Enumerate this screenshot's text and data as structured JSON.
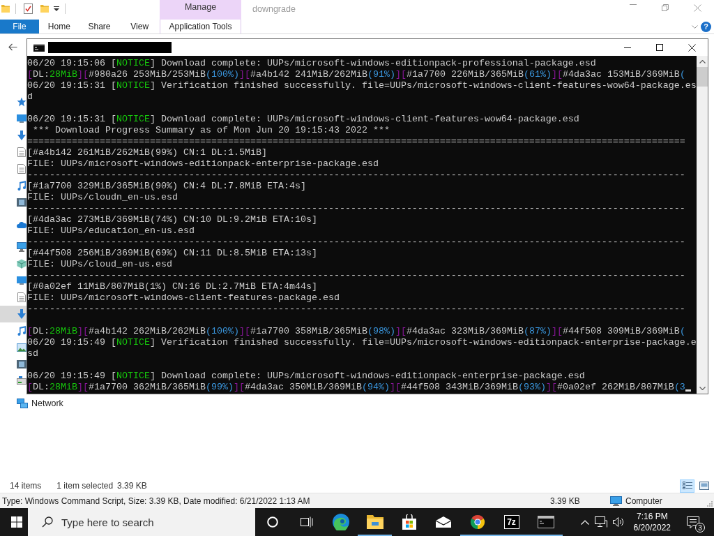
{
  "explorer": {
    "title": "downgrade",
    "contextual_tab_group": {
      "label": "Manage",
      "tab": "Application Tools"
    },
    "ribbon_tabs": [
      {
        "label": "File",
        "kind": "file"
      },
      {
        "label": "Home",
        "kind": "tab"
      },
      {
        "label": "Share",
        "kind": "tab"
      },
      {
        "label": "View",
        "kind": "tab"
      }
    ],
    "help": "?",
    "navigation_pane": {
      "groups": [
        {
          "rows": [
            {
              "kind": "star",
              "selected": false
            },
            {
              "kind": "desktop",
              "selected": false
            },
            {
              "kind": "download",
              "selected": false
            },
            {
              "kind": "document",
              "selected": false
            },
            {
              "kind": "document",
              "selected": false
            },
            {
              "kind": "music",
              "selected": false
            },
            {
              "kind": "video",
              "selected": false
            }
          ]
        },
        {
          "rows": [
            {
              "kind": "cloud",
              "selected": false
            }
          ]
        },
        {
          "rows": [
            {
              "kind": "computer",
              "selected": false
            },
            {
              "kind": "cube",
              "selected": false
            },
            {
              "kind": "desktop",
              "selected": false
            },
            {
              "kind": "document",
              "selected": false
            },
            {
              "kind": "download",
              "selected": true
            },
            {
              "kind": "music",
              "selected": false
            },
            {
              "kind": "pictures",
              "selected": false
            },
            {
              "kind": "video",
              "selected": false
            },
            {
              "kind": "drive",
              "selected": false
            }
          ]
        },
        {
          "rows": [
            {
              "kind": "network",
              "label": "Network",
              "selected": false
            }
          ]
        }
      ]
    },
    "status_bar": {
      "item_count": "14 items",
      "selection": "1 item selected",
      "selection_size": "3.39 KB"
    },
    "view_buttons": [
      {
        "kind": "details",
        "selected": true
      },
      {
        "kind": "large-icons",
        "selected": false
      }
    ],
    "details_bar": {
      "description": "Type: Windows Command Script, Size: 3.39 KB, Date modified: 6/21/2022 1:13 AM",
      "size": "3.39 KB",
      "location": "Computer"
    }
  },
  "console": {
    "cursor_visible": true,
    "lines": [
      {
        "kind": "text",
        "segments": [
          {
            "kind": "plain",
            "text": "06/20 19:15:06 ["
          },
          {
            "kind": "notice",
            "text": "NOTICE"
          },
          {
            "kind": "plain",
            "text": "] Download complete: UUPs/microsoft-windows-editionpack-professional-package.esd"
          }
        ]
      },
      {
        "kind": "text",
        "segments": [
          {
            "kind": "bracket",
            "text": "["
          },
          {
            "kind": "plain",
            "text": "DL:"
          },
          {
            "kind": "rate",
            "text": "28MiB"
          },
          {
            "kind": "bracket",
            "text": "]["
          },
          {
            "kind": "plain",
            "text": "#980a26 253MiB/253MiB"
          },
          {
            "kind": "percent",
            "text": "(100%)"
          },
          {
            "kind": "bracket",
            "text": "]["
          },
          {
            "kind": "plain",
            "text": "#a4b142 241MiB/262MiB"
          },
          {
            "kind": "percent",
            "text": "(91%)"
          },
          {
            "kind": "bracket",
            "text": "]["
          },
          {
            "kind": "plain",
            "text": "#1a7700 226MiB/365MiB"
          },
          {
            "kind": "percent",
            "text": "(61%)"
          },
          {
            "kind": "bracket",
            "text": "]["
          },
          {
            "kind": "plain",
            "text": "#4da3ac 153MiB/369MiB"
          },
          {
            "kind": "percent",
            "text": "("
          }
        ]
      },
      {
        "kind": "text",
        "segments": [
          {
            "kind": "plain",
            "text": "06/20 19:15:31 ["
          },
          {
            "kind": "notice",
            "text": "NOTICE"
          },
          {
            "kind": "plain",
            "text": "] Verification finished successfully. file=UUPs/microsoft-windows-client-features-wow64-package.es"
          }
        ]
      },
      {
        "kind": "text",
        "segments": [
          {
            "kind": "plain",
            "text": "d"
          }
        ]
      },
      {
        "kind": "blank"
      },
      {
        "kind": "text",
        "segments": [
          {
            "kind": "plain",
            "text": "06/20 19:15:31 ["
          },
          {
            "kind": "notice",
            "text": "NOTICE"
          },
          {
            "kind": "plain",
            "text": "] Download complete: UUPs/microsoft-windows-client-features-wow64-package.esd"
          }
        ]
      },
      {
        "kind": "text",
        "segments": [
          {
            "kind": "plain",
            "text": " *** Download Progress Summary as of Mon Jun 20 19:15:43 2022 ***"
          }
        ]
      },
      {
        "kind": "text",
        "segments": [
          {
            "kind": "plain",
            "text": "======================================================================================================================"
          }
        ]
      },
      {
        "kind": "text",
        "segments": [
          {
            "kind": "plain",
            "text": "[#a4b142 261MiB/262MiB(99%) CN:1 DL:1.5MiB]"
          }
        ]
      },
      {
        "kind": "text",
        "segments": [
          {
            "kind": "plain",
            "text": "FILE: UUPs/microsoft-windows-editionpack-enterprise-package.esd"
          }
        ]
      },
      {
        "kind": "text",
        "segments": [
          {
            "kind": "plain",
            "text": "----------------------------------------------------------------------------------------------------------------------"
          }
        ]
      },
      {
        "kind": "text",
        "segments": [
          {
            "kind": "plain",
            "text": "[#1a7700 329MiB/365MiB(90%) CN:4 DL:7.8MiB ETA:4s]"
          }
        ]
      },
      {
        "kind": "text",
        "segments": [
          {
            "kind": "plain",
            "text": "FILE: UUPs/cloudn_en-us.esd"
          }
        ]
      },
      {
        "kind": "text",
        "segments": [
          {
            "kind": "plain",
            "text": "----------------------------------------------------------------------------------------------------------------------"
          }
        ]
      },
      {
        "kind": "text",
        "segments": [
          {
            "kind": "plain",
            "text": "[#4da3ac 273MiB/369MiB(74%) CN:10 DL:9.2MiB ETA:10s]"
          }
        ]
      },
      {
        "kind": "text",
        "segments": [
          {
            "kind": "plain",
            "text": "FILE: UUPs/education_en-us.esd"
          }
        ]
      },
      {
        "kind": "text",
        "segments": [
          {
            "kind": "plain",
            "text": "----------------------------------------------------------------------------------------------------------------------"
          }
        ]
      },
      {
        "kind": "text",
        "segments": [
          {
            "kind": "plain",
            "text": "[#44f508 256MiB/369MiB(69%) CN:11 DL:8.5MiB ETA:13s]"
          }
        ]
      },
      {
        "kind": "text",
        "segments": [
          {
            "kind": "plain",
            "text": "FILE: UUPs/cloud_en-us.esd"
          }
        ]
      },
      {
        "kind": "text",
        "segments": [
          {
            "kind": "plain",
            "text": "----------------------------------------------------------------------------------------------------------------------"
          }
        ]
      },
      {
        "kind": "text",
        "segments": [
          {
            "kind": "plain",
            "text": "[#0a02ef 11MiB/807MiB(1%) CN:16 DL:2.7MiB ETA:4m44s]"
          }
        ]
      },
      {
        "kind": "text",
        "segments": [
          {
            "kind": "plain",
            "text": "FILE: UUPs/microsoft-windows-client-features-package.esd"
          }
        ]
      },
      {
        "kind": "text",
        "segments": [
          {
            "kind": "plain",
            "text": "----------------------------------------------------------------------------------------------------------------------"
          }
        ]
      },
      {
        "kind": "blank"
      },
      {
        "kind": "text",
        "segments": [
          {
            "kind": "bracket",
            "text": "["
          },
          {
            "kind": "plain",
            "text": "DL:"
          },
          {
            "kind": "rate",
            "text": "28MiB"
          },
          {
            "kind": "bracket",
            "text": "]["
          },
          {
            "kind": "plain",
            "text": "#a4b142 262MiB/262MiB"
          },
          {
            "kind": "percent",
            "text": "(100%)"
          },
          {
            "kind": "bracket",
            "text": "]["
          },
          {
            "kind": "plain",
            "text": "#1a7700 358MiB/365MiB"
          },
          {
            "kind": "percent",
            "text": "(98%)"
          },
          {
            "kind": "bracket",
            "text": "]["
          },
          {
            "kind": "plain",
            "text": "#4da3ac 323MiB/369MiB"
          },
          {
            "kind": "percent",
            "text": "(87%)"
          },
          {
            "kind": "bracket",
            "text": "]["
          },
          {
            "kind": "plain",
            "text": "#44f508 309MiB/369MiB"
          },
          {
            "kind": "percent",
            "text": "("
          }
        ]
      },
      {
        "kind": "text",
        "segments": [
          {
            "kind": "plain",
            "text": "06/20 19:15:49 ["
          },
          {
            "kind": "notice",
            "text": "NOTICE"
          },
          {
            "kind": "plain",
            "text": "] Verification finished successfully. file=UUPs/microsoft-windows-editionpack-enterprise-package.e"
          }
        ]
      },
      {
        "kind": "text",
        "segments": [
          {
            "kind": "plain",
            "text": "sd"
          }
        ]
      },
      {
        "kind": "blank"
      },
      {
        "kind": "text",
        "segments": [
          {
            "kind": "plain",
            "text": "06/20 19:15:49 ["
          },
          {
            "kind": "notice",
            "text": "NOTICE"
          },
          {
            "kind": "plain",
            "text": "] Download complete: UUPs/microsoft-windows-editionpack-enterprise-package.esd"
          }
        ]
      },
      {
        "kind": "text",
        "segments": [
          {
            "kind": "bracket",
            "text": "["
          },
          {
            "kind": "plain",
            "text": "DL:"
          },
          {
            "kind": "rate",
            "text": "28MiB"
          },
          {
            "kind": "bracket",
            "text": "]["
          },
          {
            "kind": "plain",
            "text": "#1a7700 362MiB/365MiB"
          },
          {
            "kind": "percent",
            "text": "(99%)"
          },
          {
            "kind": "bracket",
            "text": "]["
          },
          {
            "kind": "plain",
            "text": "#4da3ac 350MiB/369MiB"
          },
          {
            "kind": "percent",
            "text": "(94%)"
          },
          {
            "kind": "bracket",
            "text": "]["
          },
          {
            "kind": "plain",
            "text": "#44f508 343MiB/369MiB"
          },
          {
            "kind": "percent",
            "text": "(93%)"
          },
          {
            "kind": "bracket",
            "text": "]["
          },
          {
            "kind": "plain",
            "text": "#0a02ef 262MiB/807MiB"
          },
          {
            "kind": "percent",
            "text": "(3"
          }
        ]
      }
    ]
  },
  "taskbar": {
    "search": {
      "placeholder": "Type here to search"
    },
    "apps": [
      {
        "kind": "ring",
        "running": false
      },
      {
        "kind": "task-view",
        "running": false
      },
      {
        "kind": "swirl",
        "running": false
      },
      {
        "kind": "folder",
        "running": true
      },
      {
        "kind": "bag",
        "running": false
      },
      {
        "kind": "envelope",
        "running": false
      },
      {
        "kind": "wheel",
        "running": true
      },
      {
        "kind": "tile",
        "label": "7z",
        "running": true
      },
      {
        "kind": "terminal",
        "running": true
      }
    ],
    "clock": {
      "time": "7:16 PM",
      "date": "6/20/2022"
    },
    "notification_count": "3"
  }
}
